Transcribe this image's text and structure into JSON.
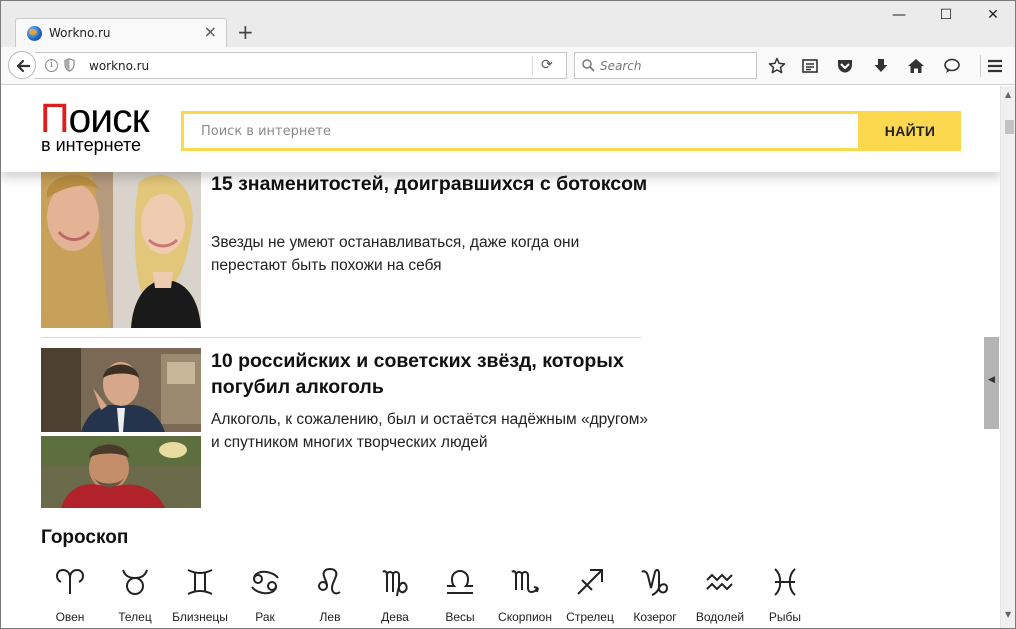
{
  "browser": {
    "tab_title": "Workno.ru",
    "tab_close_glyph": "×",
    "new_tab_glyph": "+",
    "window_controls": {
      "minimize": "—",
      "maximize": "☐",
      "close": "✕"
    },
    "url": "workno.ru",
    "info_glyph": "i",
    "reload_glyph": "⟳",
    "search_placeholder": "Search",
    "toolbar_icons": [
      "star-icon",
      "reading-list-icon",
      "pocket-icon",
      "download-icon",
      "home-icon",
      "chat-icon",
      "hamburger-menu-icon"
    ]
  },
  "site": {
    "logo_first_letter": "П",
    "logo_rest": "оиск",
    "logo_subtitle": "в интернете",
    "search_placeholder": "Поиск в интернете",
    "search_button": "НАЙТИ",
    "accent_color": "#fcd84e",
    "logo_red": "#e21c1c"
  },
  "articles": [
    {
      "title": "15 знаменитостей, доигравшихся с ботоксом",
      "description": "Звезды не умеют останавливаться, даже когда они перестают быть похожи на себя"
    },
    {
      "title": "10 российских и советских звёзд, которых погубил алкоголь",
      "description": "Алкоголь, к сожалению, был и остаётся надёжным «другом» и спутником многих творческих людей"
    }
  ],
  "horoscope": {
    "title": "Гороскоп",
    "signs": [
      {
        "name": "Овен",
        "icon": "aries-icon"
      },
      {
        "name": "Телец",
        "icon": "taurus-icon"
      },
      {
        "name": "Близнецы",
        "icon": "gemini-icon"
      },
      {
        "name": "Рак",
        "icon": "cancer-icon"
      },
      {
        "name": "Лев",
        "icon": "leo-icon"
      },
      {
        "name": "Дева",
        "icon": "virgo-icon"
      },
      {
        "name": "Весы",
        "icon": "libra-icon"
      },
      {
        "name": "Скорпион",
        "icon": "scorpio-icon"
      },
      {
        "name": "Стрелец",
        "icon": "sagittarius-icon"
      },
      {
        "name": "Козерог",
        "icon": "capricorn-icon"
      },
      {
        "name": "Водолей",
        "icon": "aquarius-icon"
      },
      {
        "name": "Рыбы",
        "icon": "pisces-icon"
      }
    ]
  }
}
